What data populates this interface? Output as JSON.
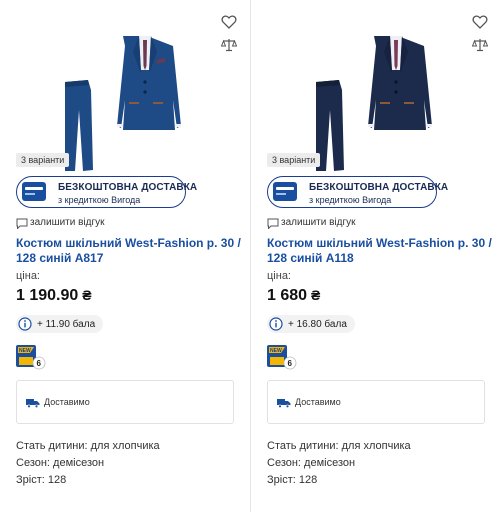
{
  "products": [
    {
      "variants_label": "3 варіанти",
      "delivery": {
        "title": "БЕЗКОШТОВНА ДОСТАВКА",
        "subtitle": "з кредиткою Вигода"
      },
      "review_label": "залишити відгук",
      "title": "Костюм шкільний West-Fashion р. 30 / 128 синій A817",
      "price_label": "ціна:",
      "price": "1 190.90",
      "currency": "₴",
      "bonus": "+ 11.90 бала",
      "new_badge": {
        "top": "NEW",
        "count": "6"
      },
      "shipping_label": "Доставимо",
      "attributes": [
        "Стать дитини: для хлопчика",
        "Сезон: демісезон",
        "Зріст: 128"
      ],
      "suit_color": "#1e4a86",
      "tie_color": "#6b3a52"
    },
    {
      "variants_label": "3 варіанти",
      "delivery": {
        "title": "БЕЗКОШТОВНА ДОСТАВКА",
        "subtitle": "з кредиткою Вигода"
      },
      "review_label": "залишити відгук",
      "title": "Костюм шкільний West-Fashion р. 30 / 128 синій A118",
      "price_label": "ціна:",
      "price": "1 680",
      "currency": "₴",
      "bonus": "+ 16.80 бала",
      "new_badge": {
        "top": "NEW",
        "count": "6"
      },
      "shipping_label": "Доставимо",
      "attributes": [
        "Стать дитини: для хлопчика",
        "Сезон: демісезон",
        "Зріст: 128"
      ],
      "suit_color": "#1c2b4c",
      "tie_color": "#7a3a5a"
    }
  ],
  "brand_color": "#1a3d8f",
  "link_color": "#1a4fa0"
}
